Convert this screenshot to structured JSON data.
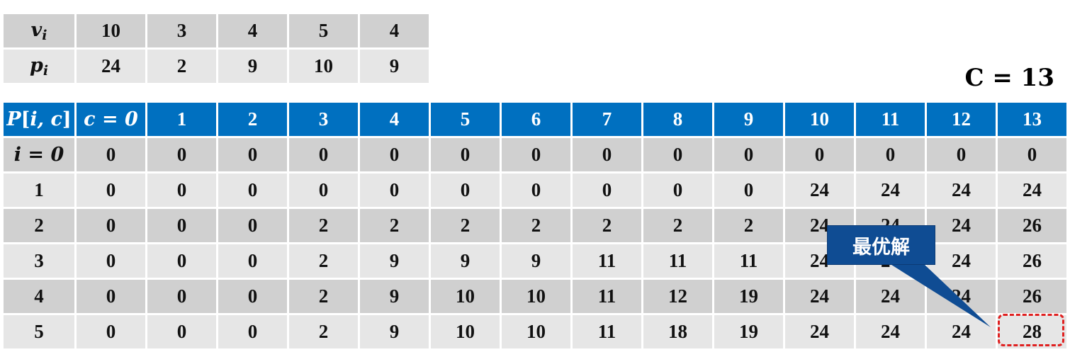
{
  "items": {
    "v_label": "v",
    "v_sub": "i",
    "p_label": "p",
    "p_sub": "i",
    "v": [
      "10",
      "3",
      "4",
      "5",
      "4"
    ],
    "p": [
      "24",
      "2",
      "9",
      "10",
      "9"
    ]
  },
  "capacity": "C = 13",
  "dp_table": {
    "corner": {
      "name": "P",
      "args": "i, c"
    },
    "first_col_header": "c = 0",
    "col_headers": [
      "1",
      "2",
      "3",
      "4",
      "5",
      "6",
      "7",
      "8",
      "9",
      "10",
      "11",
      "12",
      "13"
    ],
    "first_row_label": "i = 0",
    "row_labels": [
      "1",
      "2",
      "3",
      "4",
      "5"
    ],
    "rows": [
      [
        "0",
        "0",
        "0",
        "0",
        "0",
        "0",
        "0",
        "0",
        "0",
        "0",
        "0",
        "0",
        "0",
        "0"
      ],
      [
        "0",
        "0",
        "0",
        "0",
        "0",
        "0",
        "0",
        "0",
        "0",
        "0",
        "24",
        "24",
        "24",
        "24"
      ],
      [
        "0",
        "0",
        "0",
        "2",
        "2",
        "2",
        "2",
        "2",
        "2",
        "2",
        "24",
        "24",
        "24",
        "26"
      ],
      [
        "0",
        "0",
        "0",
        "2",
        "9",
        "9",
        "9",
        "11",
        "11",
        "11",
        "24",
        "24",
        "24",
        "26"
      ],
      [
        "0",
        "0",
        "0",
        "2",
        "9",
        "10",
        "10",
        "11",
        "12",
        "19",
        "24",
        "24",
        "24",
        "26"
      ],
      [
        "0",
        "0",
        "0",
        "2",
        "9",
        "10",
        "10",
        "11",
        "18",
        "19",
        "24",
        "24",
        "24",
        "28"
      ]
    ]
  },
  "callout": {
    "label": "最优解",
    "color": "#0f4c93",
    "highlight_color": "#e02020"
  },
  "colors": {
    "header_blue": "#0070c0",
    "row_dark": "#d0d0d0",
    "row_light": "#e6e6e6"
  }
}
